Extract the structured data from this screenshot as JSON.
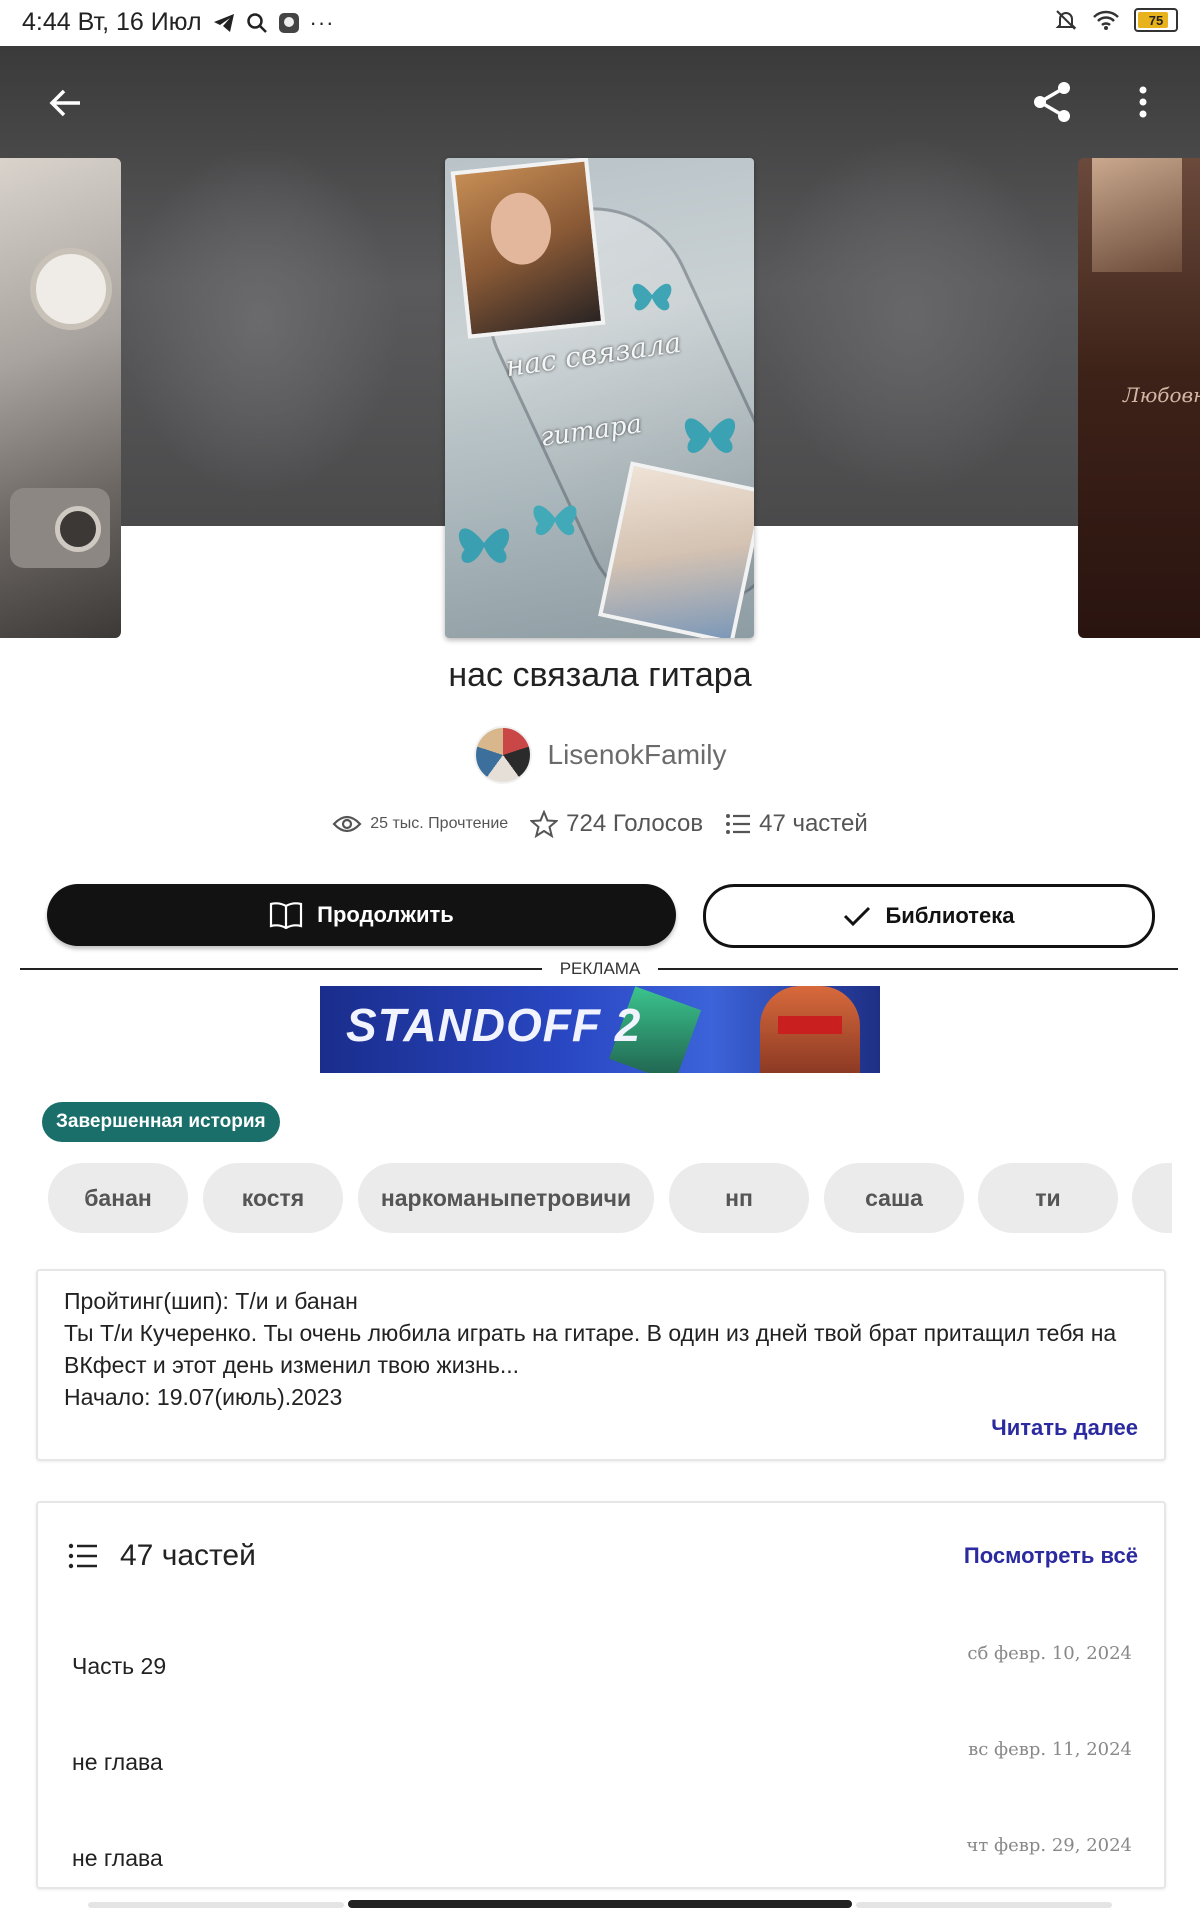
{
  "status_bar": {
    "time_date": "4:44 Вт, 16 Июл",
    "battery_level": "75"
  },
  "cover": {
    "title_line1": "нас связала",
    "title_line2": "гитара",
    "side_right_text": "Любовн"
  },
  "story": {
    "title": "нас связала гитара",
    "author": "LisenokFamily",
    "views": "25 тыс. Прочтение",
    "votes": "724 Голосов",
    "parts_count": "47 частей"
  },
  "actions": {
    "continue_label": "Продолжить",
    "library_label": "Библиотека"
  },
  "ad": {
    "label": "РЕКЛАМА",
    "banner_text": "STANDOFF 2"
  },
  "completed_badge": "Завершенная история",
  "tags": [
    "банан",
    "костя",
    "наркоманыпетровичи",
    "нп",
    "саша",
    "ти"
  ],
  "description": {
    "line1": "Пройтинг(шип): Т/и и банан",
    "line2": "Ты Т/и Кучеренко. Ты очень любила играть на гитаре. В один из дней твой брат притащил тебя на ВКфест и этот день изменил твою жизнь...",
    "line3": "Начало: 19.07(июль).2023",
    "read_more": "Читать далее"
  },
  "parts": {
    "title": "47 частей",
    "view_all": "Посмотреть всё",
    "items": [
      {
        "title": "Часть 29",
        "date": "сб февр. 10, 2024"
      },
      {
        "title": "не глава",
        "date": "вс февр. 11, 2024"
      },
      {
        "title": "не глава",
        "date": "чт февр. 29, 2024"
      }
    ]
  },
  "colors": {
    "accent_link": "#2b2a9f",
    "badge": "#1a6f6a",
    "primary_button": "#121212"
  }
}
